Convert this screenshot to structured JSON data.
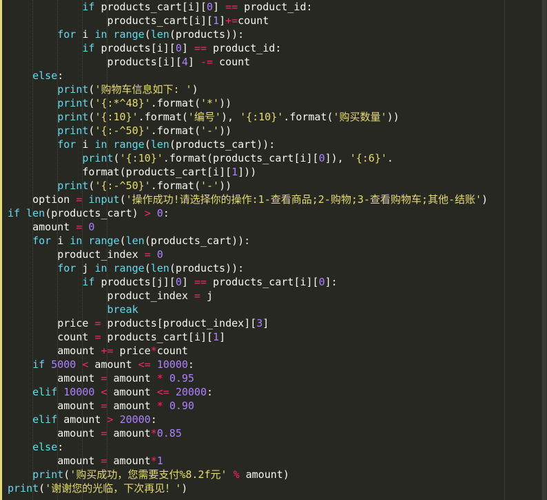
{
  "theme": {
    "background": "#272822",
    "keyword": "#66d9ef",
    "string": "#e6db74",
    "number": "#ae81ff",
    "operator": "#f92672",
    "text": "#f8f8f2"
  },
  "code_lines": [
    [
      [
        "",
        "            "
      ],
      [
        "kw",
        "if"
      ],
      [
        "nm",
        " products_cart"
      ],
      [
        "pn",
        "["
      ],
      [
        "nm",
        "i"
      ],
      [
        "pn",
        "]["
      ],
      [
        "num",
        "0"
      ],
      [
        "pn",
        "] "
      ],
      [
        "op",
        "=="
      ],
      [
        "nm",
        " product_id"
      ],
      [
        "pn",
        ":"
      ]
    ],
    [
      [
        "",
        "                "
      ],
      [
        "nm",
        "products_cart"
      ],
      [
        "pn",
        "["
      ],
      [
        "nm",
        "i"
      ],
      [
        "pn",
        "]["
      ],
      [
        "num",
        "1"
      ],
      [
        "pn",
        "]"
      ],
      [
        "op",
        "+="
      ],
      [
        "nm",
        "count"
      ]
    ],
    [
      [
        "",
        "        "
      ],
      [
        "kw",
        "for"
      ],
      [
        "nm",
        " i "
      ],
      [
        "kw",
        "in"
      ],
      [
        "nm",
        " "
      ],
      [
        "kw",
        "range"
      ],
      [
        "pn",
        "("
      ],
      [
        "kw",
        "len"
      ],
      [
        "pn",
        "("
      ],
      [
        "nm",
        "products"
      ],
      [
        "pn",
        ")):"
      ]
    ],
    [
      [
        "",
        "            "
      ],
      [
        "kw",
        "if"
      ],
      [
        "nm",
        " products"
      ],
      [
        "pn",
        "["
      ],
      [
        "nm",
        "i"
      ],
      [
        "pn",
        "]["
      ],
      [
        "num",
        "0"
      ],
      [
        "pn",
        "] "
      ],
      [
        "op",
        "=="
      ],
      [
        "nm",
        " product_id"
      ],
      [
        "pn",
        ":"
      ]
    ],
    [
      [
        "",
        "                "
      ],
      [
        "nm",
        "products"
      ],
      [
        "pn",
        "["
      ],
      [
        "nm",
        "i"
      ],
      [
        "pn",
        "]["
      ],
      [
        "num",
        "4"
      ],
      [
        "pn",
        "] "
      ],
      [
        "op",
        "-="
      ],
      [
        "nm",
        " count"
      ]
    ],
    [
      [
        "",
        "    "
      ],
      [
        "kw",
        "else"
      ],
      [
        "pn",
        ":"
      ]
    ],
    [
      [
        "",
        "        "
      ],
      [
        "kw",
        "print"
      ],
      [
        "pn",
        "("
      ],
      [
        "str",
        "'购物车信息如下: '"
      ],
      [
        "pn",
        ")"
      ]
    ],
    [
      [
        "",
        "        "
      ],
      [
        "kw",
        "print"
      ],
      [
        "pn",
        "("
      ],
      [
        "str",
        "'{:*^48}'"
      ],
      [
        "pn",
        "."
      ],
      [
        "nm",
        "format"
      ],
      [
        "pn",
        "("
      ],
      [
        "str",
        "'*'"
      ],
      [
        "pn",
        "))"
      ]
    ],
    [
      [
        "",
        "        "
      ],
      [
        "kw",
        "print"
      ],
      [
        "pn",
        "("
      ],
      [
        "str",
        "'{:10}'"
      ],
      [
        "pn",
        "."
      ],
      [
        "nm",
        "format"
      ],
      [
        "pn",
        "("
      ],
      [
        "str",
        "'编号'"
      ],
      [
        "pn",
        "), "
      ],
      [
        "str",
        "'{:10}'"
      ],
      [
        "pn",
        "."
      ],
      [
        "nm",
        "format"
      ],
      [
        "pn",
        "("
      ],
      [
        "str",
        "'购买数量'"
      ],
      [
        "pn",
        "))"
      ]
    ],
    [
      [
        "",
        "        "
      ],
      [
        "kw",
        "print"
      ],
      [
        "pn",
        "("
      ],
      [
        "str",
        "'{:-^50}'"
      ],
      [
        "pn",
        "."
      ],
      [
        "nm",
        "format"
      ],
      [
        "pn",
        "("
      ],
      [
        "str",
        "'-'"
      ],
      [
        "pn",
        "))"
      ]
    ],
    [
      [
        "",
        "        "
      ],
      [
        "kw",
        "for"
      ],
      [
        "nm",
        " i "
      ],
      [
        "kw",
        "in"
      ],
      [
        "nm",
        " "
      ],
      [
        "kw",
        "range"
      ],
      [
        "pn",
        "("
      ],
      [
        "kw",
        "len"
      ],
      [
        "pn",
        "("
      ],
      [
        "nm",
        "products_cart"
      ],
      [
        "pn",
        ")):"
      ]
    ],
    [
      [
        "",
        "            "
      ],
      [
        "kw",
        "print"
      ],
      [
        "pn",
        "("
      ],
      [
        "str",
        "'{:10}'"
      ],
      [
        "pn",
        "."
      ],
      [
        "nm",
        "format"
      ],
      [
        "pn",
        "("
      ],
      [
        "nm",
        "products_cart"
      ],
      [
        "pn",
        "["
      ],
      [
        "nm",
        "i"
      ],
      [
        "pn",
        "]["
      ],
      [
        "num",
        "0"
      ],
      [
        "pn",
        "]), "
      ],
      [
        "str",
        "'{:6}'"
      ],
      [
        "pn",
        "."
      ]
    ],
    [
      [
        "",
        "            "
      ],
      [
        "nm",
        "format"
      ],
      [
        "pn",
        "("
      ],
      [
        "nm",
        "products_cart"
      ],
      [
        "pn",
        "["
      ],
      [
        "nm",
        "i"
      ],
      [
        "pn",
        "]["
      ],
      [
        "num",
        "1"
      ],
      [
        "pn",
        "]))"
      ]
    ],
    [
      [
        "",
        "        "
      ],
      [
        "kw",
        "print"
      ],
      [
        "pn",
        "("
      ],
      [
        "str",
        "'{:-^50}'"
      ],
      [
        "pn",
        "."
      ],
      [
        "nm",
        "format"
      ],
      [
        "pn",
        "("
      ],
      [
        "str",
        "'-'"
      ],
      [
        "pn",
        "))"
      ]
    ],
    [
      [
        "",
        "    "
      ],
      [
        "nm",
        "option "
      ],
      [
        "op",
        "="
      ],
      [
        "nm",
        " "
      ],
      [
        "kw",
        "input"
      ],
      [
        "pn",
        "("
      ],
      [
        "str",
        "'操作成功!请选择你的操作:1-查看商品;2-购物;3-查看购物车;其他-结账'"
      ],
      [
        "pn",
        ")"
      ]
    ],
    [
      [
        "kw",
        "if"
      ],
      [
        "nm",
        " "
      ],
      [
        "kw",
        "len"
      ],
      [
        "pn",
        "("
      ],
      [
        "nm",
        "products_cart"
      ],
      [
        "pn",
        ") "
      ],
      [
        "op",
        ">"
      ],
      [
        "nm",
        " "
      ],
      [
        "num",
        "0"
      ],
      [
        "pn",
        ":"
      ]
    ],
    [
      [
        "",
        "    "
      ],
      [
        "nm",
        "amount "
      ],
      [
        "op",
        "="
      ],
      [
        "nm",
        " "
      ],
      [
        "num",
        "0"
      ]
    ],
    [
      [
        "",
        "    "
      ],
      [
        "kw",
        "for"
      ],
      [
        "nm",
        " i "
      ],
      [
        "kw",
        "in"
      ],
      [
        "nm",
        " "
      ],
      [
        "kw",
        "range"
      ],
      [
        "pn",
        "("
      ],
      [
        "kw",
        "len"
      ],
      [
        "pn",
        "("
      ],
      [
        "nm",
        "products_cart"
      ],
      [
        "pn",
        ")):"
      ]
    ],
    [
      [
        "",
        "        "
      ],
      [
        "nm",
        "product_index "
      ],
      [
        "op",
        "="
      ],
      [
        "nm",
        " "
      ],
      [
        "num",
        "0"
      ]
    ],
    [
      [
        "",
        "        "
      ],
      [
        "kw",
        "for"
      ],
      [
        "nm",
        " j "
      ],
      [
        "kw",
        "in"
      ],
      [
        "nm",
        " "
      ],
      [
        "kw",
        "range"
      ],
      [
        "pn",
        "("
      ],
      [
        "kw",
        "len"
      ],
      [
        "pn",
        "("
      ],
      [
        "nm",
        "products"
      ],
      [
        "pn",
        ")):"
      ]
    ],
    [
      [
        "",
        "            "
      ],
      [
        "kw",
        "if"
      ],
      [
        "nm",
        " products"
      ],
      [
        "pn",
        "["
      ],
      [
        "nm",
        "j"
      ],
      [
        "pn",
        "]["
      ],
      [
        "num",
        "0"
      ],
      [
        "pn",
        "] "
      ],
      [
        "op",
        "=="
      ],
      [
        "nm",
        " products_cart"
      ],
      [
        "pn",
        "["
      ],
      [
        "nm",
        "i"
      ],
      [
        "pn",
        "]["
      ],
      [
        "num",
        "0"
      ],
      [
        "pn",
        "]:"
      ]
    ],
    [
      [
        "",
        "                "
      ],
      [
        "nm",
        "product_index "
      ],
      [
        "op",
        "="
      ],
      [
        "nm",
        " j"
      ]
    ],
    [
      [
        "",
        "                "
      ],
      [
        "kw",
        "break"
      ]
    ],
    [
      [
        "",
        "        "
      ],
      [
        "nm",
        "price "
      ],
      [
        "op",
        "="
      ],
      [
        "nm",
        " products"
      ],
      [
        "pn",
        "["
      ],
      [
        "nm",
        "product_index"
      ],
      [
        "pn",
        "]["
      ],
      [
        "num",
        "3"
      ],
      [
        "pn",
        "]"
      ]
    ],
    [
      [
        "",
        "        "
      ],
      [
        "nm",
        "count "
      ],
      [
        "op",
        "="
      ],
      [
        "nm",
        " products_cart"
      ],
      [
        "pn",
        "["
      ],
      [
        "nm",
        "i"
      ],
      [
        "pn",
        "]["
      ],
      [
        "num",
        "1"
      ],
      [
        "pn",
        "]"
      ]
    ],
    [
      [
        "",
        "        "
      ],
      [
        "nm",
        "amount "
      ],
      [
        "op",
        "+="
      ],
      [
        "nm",
        " price"
      ],
      [
        "op",
        "*"
      ],
      [
        "nm",
        "count"
      ]
    ],
    [
      [
        "",
        "    "
      ],
      [
        "kw",
        "if"
      ],
      [
        "nm",
        " "
      ],
      [
        "num",
        "5000"
      ],
      [
        "nm",
        " "
      ],
      [
        "op",
        "<"
      ],
      [
        "nm",
        " amount "
      ],
      [
        "op",
        "<="
      ],
      [
        "nm",
        " "
      ],
      [
        "num",
        "10000"
      ],
      [
        "pn",
        ":"
      ]
    ],
    [
      [
        "",
        "        "
      ],
      [
        "nm",
        "amount "
      ],
      [
        "op",
        "="
      ],
      [
        "nm",
        " amount "
      ],
      [
        "op",
        "*"
      ],
      [
        "nm",
        " "
      ],
      [
        "num",
        "0.95"
      ]
    ],
    [
      [
        "",
        "    "
      ],
      [
        "kw",
        "elif"
      ],
      [
        "nm",
        " "
      ],
      [
        "num",
        "10000"
      ],
      [
        "nm",
        " "
      ],
      [
        "op",
        "<"
      ],
      [
        "nm",
        " amount "
      ],
      [
        "op",
        "<="
      ],
      [
        "nm",
        " "
      ],
      [
        "num",
        "20000"
      ],
      [
        "pn",
        ":"
      ]
    ],
    [
      [
        "",
        "        "
      ],
      [
        "nm",
        "amount "
      ],
      [
        "op",
        "="
      ],
      [
        "nm",
        " amount "
      ],
      [
        "op",
        "*"
      ],
      [
        "nm",
        " "
      ],
      [
        "num",
        "0.90"
      ]
    ],
    [
      [
        "",
        "    "
      ],
      [
        "kw",
        "elif"
      ],
      [
        "nm",
        " amount "
      ],
      [
        "op",
        ">"
      ],
      [
        "nm",
        " "
      ],
      [
        "num",
        "20000"
      ],
      [
        "pn",
        ":"
      ]
    ],
    [
      [
        "",
        "        "
      ],
      [
        "nm",
        "amount "
      ],
      [
        "op",
        "="
      ],
      [
        "nm",
        " amount"
      ],
      [
        "op",
        "*"
      ],
      [
        "num",
        "0.85"
      ]
    ],
    [
      [
        "",
        "    "
      ],
      [
        "kw",
        "else"
      ],
      [
        "pn",
        ":"
      ]
    ],
    [
      [
        "",
        "        "
      ],
      [
        "nm",
        "amount "
      ],
      [
        "op",
        "="
      ],
      [
        "nm",
        " amount"
      ],
      [
        "op",
        "*"
      ],
      [
        "num",
        "1"
      ]
    ],
    [
      [
        "",
        "    "
      ],
      [
        "kw",
        "print"
      ],
      [
        "pn",
        "("
      ],
      [
        "str",
        "'购买成功，您需要支付%8.2f元'"
      ],
      [
        "nm",
        " "
      ],
      [
        "op",
        "%"
      ],
      [
        "nm",
        " amount"
      ],
      [
        "pn",
        ")"
      ]
    ],
    [
      [
        "kw",
        "print"
      ],
      [
        "pn",
        "("
      ],
      [
        "str",
        "'谢谢您的光临，下次再见！'"
      ],
      [
        "pn",
        ")"
      ]
    ]
  ]
}
